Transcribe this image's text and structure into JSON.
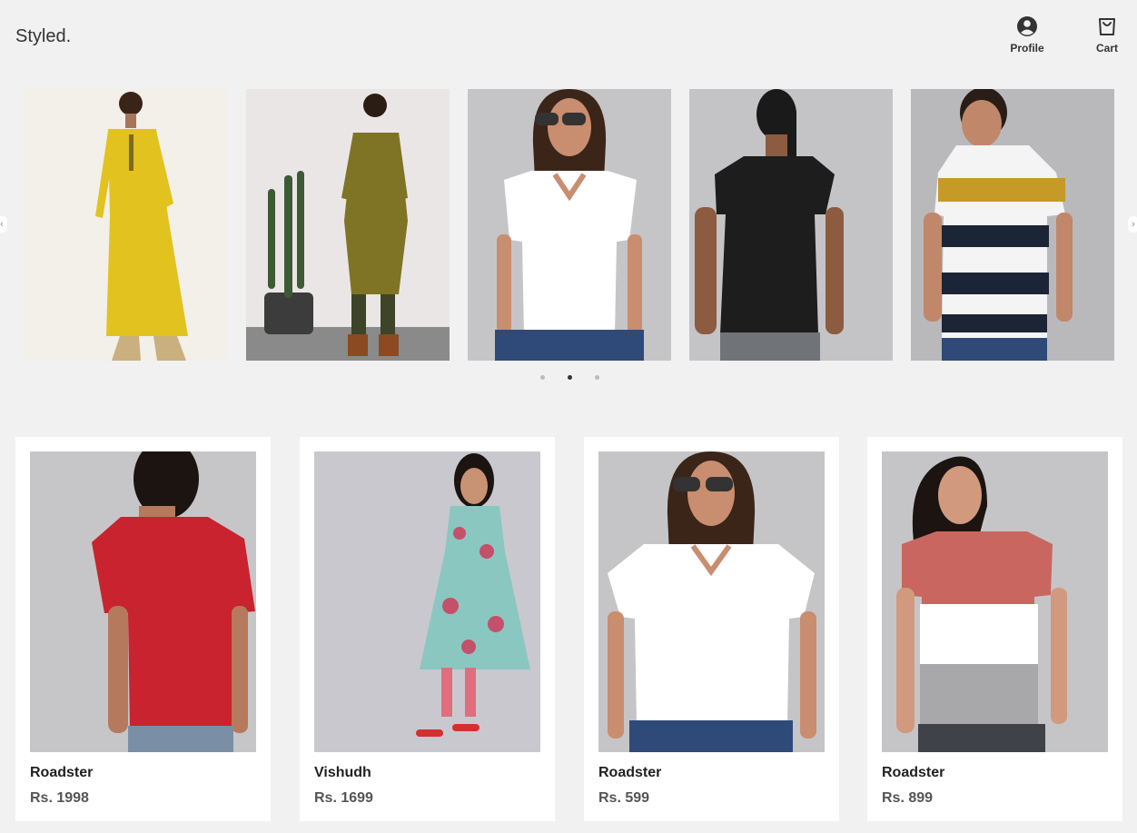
{
  "header": {
    "logo": "Styled.",
    "profile_label": "Profile",
    "cart_label": "Cart",
    "profile_icon": "user-circle-icon",
    "cart_icon": "shopping-bag-icon"
  },
  "carousel": {
    "slides": [
      {
        "description": "yellow kurta",
        "bg": "#f3efe9",
        "garment": "#e2c21e"
      },
      {
        "description": "olive printed kurta",
        "bg": "#ebe6e6",
        "garment": "#7f7425"
      },
      {
        "description": "white v-neck tee",
        "bg": "#c5c5c7",
        "garment": "#ffffff"
      },
      {
        "description": "black tee",
        "bg": "#c4c4c6",
        "garment": "#1d1d1d"
      },
      {
        "description": "striped polo",
        "bg": "#b9b9bb",
        "garment": "#f4f4f4"
      }
    ],
    "active_dot": 1,
    "dot_count": 3
  },
  "products": [
    {
      "brand": "Roadster",
      "price": "Rs. 1998"
    },
    {
      "brand": "Vishudh",
      "price": "Rs. 1699"
    },
    {
      "brand": "Roadster",
      "price": "Rs. 599"
    },
    {
      "brand": "Roadster",
      "price": "Rs. 899"
    }
  ],
  "colors": {
    "page_bg": "#f1f1f1",
    "card_bg": "#ffffff",
    "dot_active": "#333333",
    "dot_inactive": "#bbbbbb"
  }
}
